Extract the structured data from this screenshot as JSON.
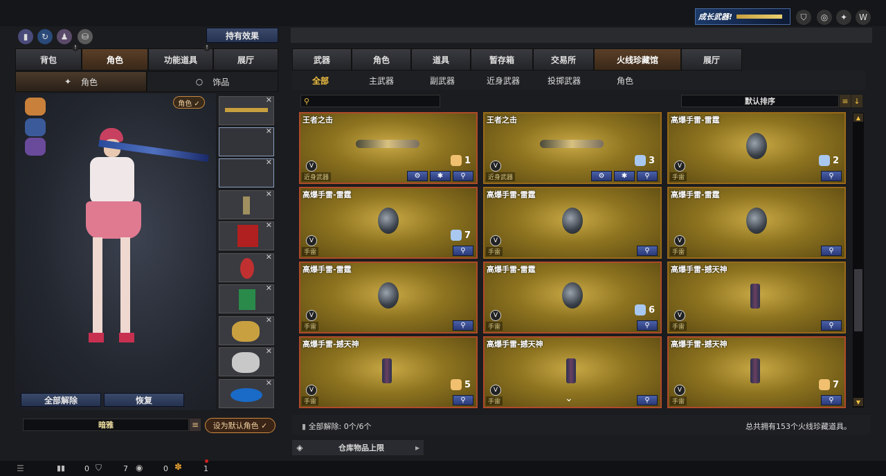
{
  "top": {
    "banner_text": "成长武器!",
    "left_tab_label": "持有效果"
  },
  "left": {
    "tabs": [
      {
        "label": "背包",
        "badge": "!"
      },
      {
        "label": "角色"
      },
      {
        "label": "功能道具",
        "badge": "!"
      },
      {
        "label": "展厅"
      }
    ],
    "subtabs": [
      "角色",
      "饰品"
    ],
    "role_tag": "角色 ✓",
    "btn_unequip_all": "全部解除",
    "btn_restore": "恢复",
    "name_value": "暗雅",
    "btn_set_default": "设为默认角色 ✓"
  },
  "right": {
    "tabs": [
      "武器",
      "角色",
      "道具",
      "暂存箱",
      "交易所",
      "火线珍藏馆",
      "展厅"
    ],
    "subtabs": [
      "全部",
      "主武器",
      "副武器",
      "近身武器",
      "投掷武器",
      "角色"
    ],
    "search_placeholder": "",
    "sort_label": "默认排序",
    "status_left": "全部解除: 0个/6个",
    "status_right": "总共拥有153个火线珍藏道具。",
    "storage_label": "仓库物品上限"
  },
  "cards": [
    {
      "name": "王者之击",
      "tag": "近身武器",
      "qty": "1",
      "icon": "sword",
      "acts": 3
    },
    {
      "name": "王者之击",
      "tag": "近身武器",
      "qty": "3",
      "icon": "sword",
      "acts": 3,
      "blue": true
    },
    {
      "name": "高爆手雷-雷霆",
      "tag": "手雷",
      "qty": "2",
      "icon": "grenade",
      "acts": 1,
      "blue": true
    },
    {
      "name": "高爆手雷-雷霆",
      "tag": "手雷",
      "qty": "7",
      "icon": "grenade",
      "acts": 1,
      "blue": true
    },
    {
      "name": "高爆手雷-雷霆",
      "tag": "手雷",
      "qty": "",
      "icon": "grenade",
      "acts": 1
    },
    {
      "name": "高爆手雷-雷霆",
      "tag": "手雷",
      "qty": "",
      "icon": "grenade",
      "acts": 1
    },
    {
      "name": "高爆手雷-雷霆",
      "tag": "手雷",
      "qty": "",
      "icon": "grenade",
      "acts": 1
    },
    {
      "name": "高爆手雷-雷霆",
      "tag": "手雷",
      "qty": "6",
      "icon": "grenade",
      "acts": 1,
      "blue": true
    },
    {
      "name": "高爆手雷-撼天神",
      "tag": "手雷",
      "qty": "",
      "icon": "bar",
      "acts": 1
    },
    {
      "name": "高爆手雷-撼天神",
      "tag": "手雷",
      "qty": "5",
      "icon": "bar",
      "acts": 1
    },
    {
      "name": "高爆手雷-撼天神",
      "tag": "手雷",
      "qty": "",
      "icon": "bar",
      "acts": 1
    },
    {
      "name": "高爆手雷-撼天神",
      "tag": "手雷",
      "qty": "7",
      "icon": "bar",
      "acts": 1
    }
  ],
  "bottom": {
    "count_a": "0",
    "count_b": "7",
    "count_c": "0",
    "count_d": "1"
  }
}
